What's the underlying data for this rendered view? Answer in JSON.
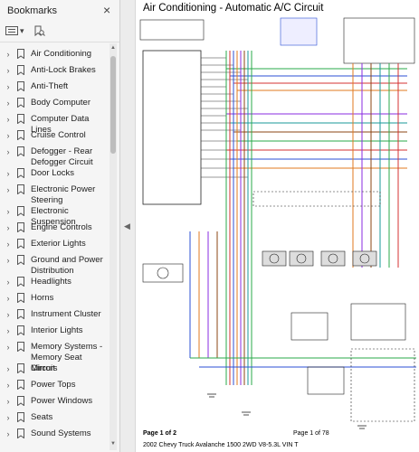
{
  "sidebar": {
    "title": "Bookmarks",
    "items": [
      {
        "label": "Air Conditioning"
      },
      {
        "label": "Anti-Lock Brakes"
      },
      {
        "label": "Anti-Theft"
      },
      {
        "label": "Body Computer"
      },
      {
        "label": "Computer Data Lines"
      },
      {
        "label": "Cruise Control"
      },
      {
        "label": "Defogger - Rear Defogger Circuit"
      },
      {
        "label": "Door Locks"
      },
      {
        "label": "Electronic Power Steering"
      },
      {
        "label": "Electronic Suspension"
      },
      {
        "label": "Engine Controls"
      },
      {
        "label": "Exterior Lights"
      },
      {
        "label": "Ground and Power Distribution"
      },
      {
        "label": "Headlights"
      },
      {
        "label": "Horns"
      },
      {
        "label": "Instrument Cluster"
      },
      {
        "label": "Interior Lights"
      },
      {
        "label": "Memory Systems - Memory Seat Circuit"
      },
      {
        "label": "Mirrors"
      },
      {
        "label": "Power Tops"
      },
      {
        "label": "Power Windows"
      },
      {
        "label": "Seats"
      },
      {
        "label": "Sound Systems"
      }
    ]
  },
  "document": {
    "title": "Air Conditioning - Automatic A/C Circuit",
    "page_label": "Page 1 of 2",
    "page_counter": "Page 1 of 78",
    "vehicle": "2002 Chevy Truck Avalanche 1500 2WD V8-5.3L VIN T"
  },
  "colors": {
    "wire_green": "#2aa84a",
    "wire_red": "#d43030",
    "wire_blue": "#2b4fd6",
    "wire_orange": "#e07a1f",
    "wire_purple": "#8a2be2",
    "wire_brown": "#8b4513",
    "wire_teal": "#1a9a9a"
  }
}
